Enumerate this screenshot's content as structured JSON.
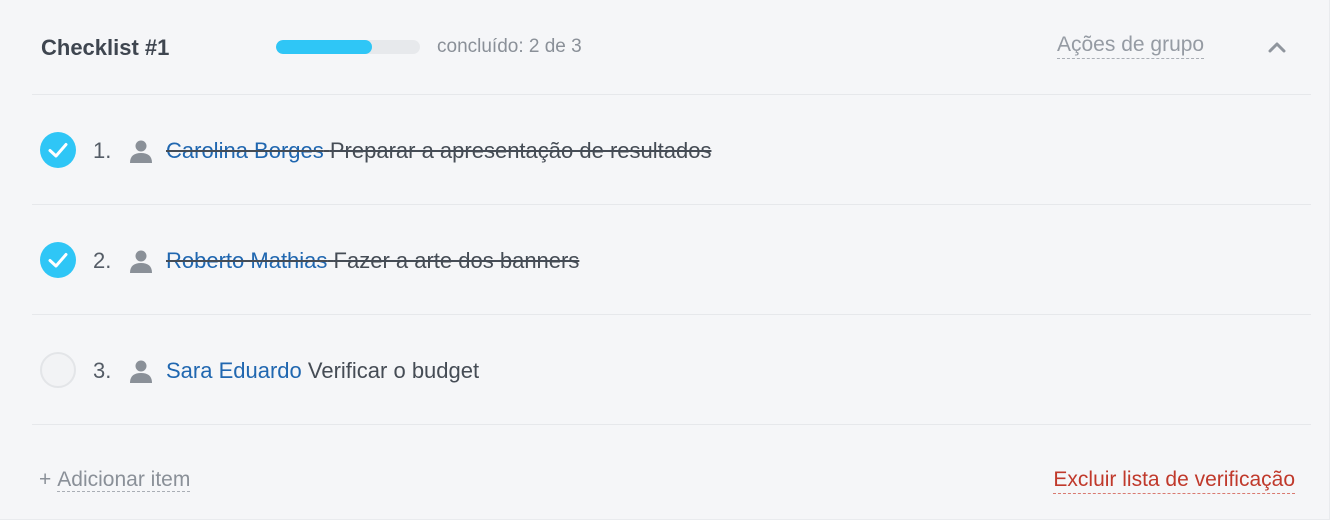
{
  "checklist": {
    "title": "Checklist #1",
    "progress": {
      "completed": 2,
      "total": 3,
      "fraction": 0.667,
      "label": "concluído: 2 de 3",
      "fill_color": "#2fc6f6"
    },
    "group_actions_label": "Ações de grupo",
    "collapse_icon": "chevron-up-icon"
  },
  "items": [
    {
      "number": "1.",
      "assignee": "Carolina Borges",
      "task": "Preparar a apresentação de resultados",
      "done": true
    },
    {
      "number": "2.",
      "assignee": "Roberto Mathias",
      "task": "Fazer a arte dos banners",
      "done": true
    },
    {
      "number": "3.",
      "assignee": "Sara Eduardo",
      "task": "Verificar o budget",
      "done": false
    }
  ],
  "footer": {
    "add_plus": "+",
    "add_item_label": "Adicionar item",
    "delete_label": "Excluir lista de verificação"
  },
  "colors": {
    "accent": "#2fc6f6",
    "link": "#2067b0",
    "danger": "#c0392b"
  }
}
